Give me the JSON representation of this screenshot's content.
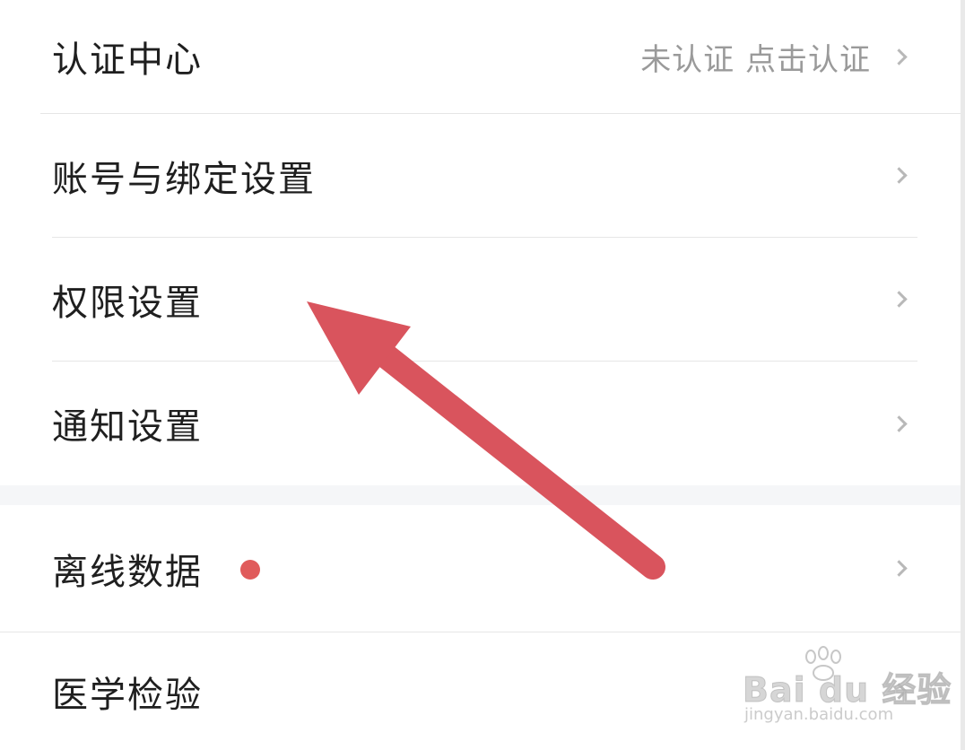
{
  "settings": {
    "items": [
      {
        "label": "认证中心",
        "value": "未认证 点击认证"
      },
      {
        "label": "账号与绑定设置"
      },
      {
        "label": "权限设置"
      },
      {
        "label": "通知设置"
      },
      {
        "label": "离线数据"
      },
      {
        "label": "医学检验"
      }
    ]
  },
  "colors": {
    "arrow": "#d9545d",
    "badge": "#e05b5b",
    "text": "#1f1f1f",
    "secondary_text": "#9a9a9a",
    "divider": "#e6e6e6"
  },
  "watermark": {
    "brand": "Bai du 经验",
    "url": "jingyan.baidu.com"
  },
  "icons": {
    "chevron": "chevron-right-icon",
    "annotation": "red-arrow-annotation",
    "badge": "red-dot-badge"
  }
}
